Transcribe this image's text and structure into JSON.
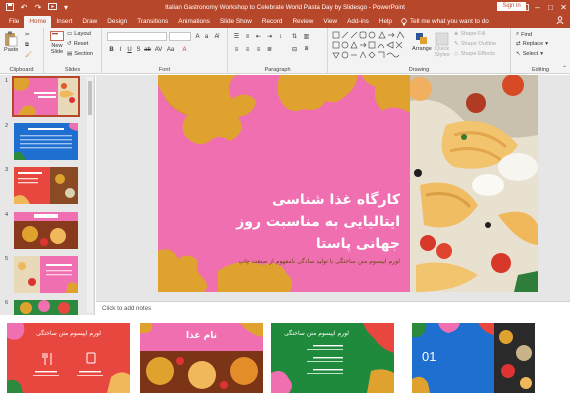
{
  "window": {
    "title": "Italian Gastronomy Workshop to Celebrate World Pasta Day by Slidesgo  -  PowerPoint",
    "signin": "Sign in",
    "accent": "#b7472a"
  },
  "tabs": {
    "items": [
      "File",
      "Home",
      "Insert",
      "Draw",
      "Design",
      "Transitions",
      "Animations",
      "Slide Show",
      "Record",
      "Review",
      "View",
      "Add-ins",
      "Help"
    ],
    "active": "Home",
    "tell_me": "Tell me what you want to do"
  },
  "ribbon": {
    "clipboard": {
      "label": "Clipboard",
      "paste": "Paste"
    },
    "slides": {
      "label": "Slides",
      "new_slide": "New Slide",
      "layout": "Layout",
      "reset": "Reset",
      "section": "Section"
    },
    "font": {
      "label": "Font"
    },
    "paragraph": {
      "label": "Paragraph"
    },
    "drawing": {
      "label": "Drawing",
      "arrange": "Arrange",
      "quick_styles": "Quick Styles",
      "shape_fill": "Shape Fill",
      "shape_outline": "Shape Outline",
      "shape_effects": "Shape Effects"
    },
    "editing": {
      "label": "Editing",
      "find": "Find",
      "replace": "Replace",
      "select": "Select"
    }
  },
  "thumbnails": {
    "numbers": [
      "1",
      "2",
      "3",
      "4",
      "5",
      "6"
    ]
  },
  "slide": {
    "title": "کارگاه غذا شناسی ایتالیایی به مناسبت روز جهانی پاستا",
    "subtitle": "لورم ایپسوم متن ساختگی با تولید سادگی نامفهوم از صنعت چاپ",
    "bg_color": "#f06fb0",
    "blob_color": "#e0a22f",
    "text_color": "#ffffff",
    "subtitle_color": "#6b4a12"
  },
  "notes": {
    "placeholder": "Click to add notes"
  },
  "bottom_previews": {
    "one": {
      "title": "لورم ایپسوم متن ساختگی"
    },
    "two": {
      "title": "نام غذا"
    },
    "three": {
      "title": "لورم ایپسوم متن ساختگی"
    },
    "four": {
      "number": "01"
    }
  }
}
